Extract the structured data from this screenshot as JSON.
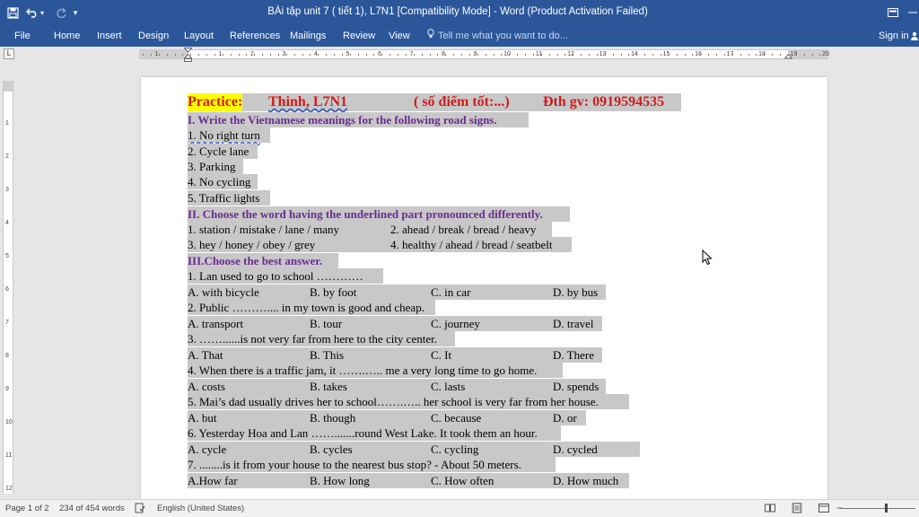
{
  "window": {
    "title": "BÀi tập unit 7 ( tiết 1), L7N1 [Compatibility Mode] - Word (Product Activation Failed)"
  },
  "quick_access": {
    "save_icon": "save-icon",
    "undo_icon": "undo-icon",
    "redo_icon": "redo-icon",
    "customize_icon": "customize-icon"
  },
  "ribbon": {
    "tabs": [
      "File",
      "Home",
      "Insert",
      "Design",
      "Layout",
      "References",
      "Mailings",
      "Review",
      "View"
    ],
    "tell_me": "Tell me what you want to do...",
    "sign_in": "Sign in"
  },
  "ruler": {
    "numbers": [
      "1",
      "1",
      "2",
      "3",
      "4",
      "5",
      "6",
      "7",
      "8",
      "9",
      "10",
      "11",
      "12",
      "13",
      "14",
      "15",
      "16",
      "17",
      "18",
      "19",
      "20"
    ]
  },
  "vruler": {
    "numbers": [
      "1",
      "2",
      "3",
      "4",
      "5",
      "6",
      "7",
      "8",
      "9",
      "10",
      "11",
      "12"
    ]
  },
  "document": {
    "header": {
      "practice": "Practice:",
      "name": "Thinh, L7N1",
      "score": "( số điểm tốt:...)",
      "phone": "Đth gv: 0919594535"
    },
    "section1": {
      "title": "I. Write the Vietnamese meanings for the following road signs.",
      "items": [
        "1. No right turn",
        "2. Cycle lane",
        "3. Parking",
        "4. No cycling",
        "5. Traffic lights"
      ]
    },
    "section2": {
      "title": "II. Choose the word having the underlined part pronounced differently.",
      "q1": "1. station / mistake / lane / many",
      "q2": "2. ahead / break / bread / heavy",
      "q3": "3. hey / honey / obey / grey",
      "q4": "4. healthy / ahead / bread / seatbelt"
    },
    "section3": {
      "title": "III.Choose the best answer.",
      "questions": [
        {
          "q": "1. Lan used to go to school …………",
          "a": "A. with bicycle",
          "b": "B. by foot",
          "c": "C. in car",
          "d": "D. by bus"
        },
        {
          "q": "2. Public ……….... in my town is good and cheap.",
          "a": "A. transport",
          "b": "B. tour",
          "c": "C. journey",
          "d": "D. travel"
        },
        {
          "q": "3. ……......is not very far from here to the city center.",
          "a": "A. That",
          "b": "B. This",
          "c": "C. It",
          "d": "D. There"
        },
        {
          "q": "4. When there is a traffic jam, it …….….. me a very long time to go home.",
          "a": "A. costs",
          "b": "B. takes",
          "c": "C. lasts",
          "d": "D. spends"
        },
        {
          "q": "5. Mai’s dad usually drives her to school…….….. her school is very far from her house.",
          "a": "A. but",
          "b": "B. though",
          "c": "C. because",
          "d": "D. or"
        },
        {
          "q": "6. Yesterday Hoa and Lan …….......round West Lake. It took them an hour.",
          "a": "A. cycle",
          "b": "B. cycles",
          "c": "C. cycling",
          "d": "D. cycled"
        },
        {
          "q": "7. ........is it from your house to the nearest bus stop?  -  About 50 meters.",
          "a": "A.How far",
          "b": "B. How long",
          "c": "C. How often",
          "d": "D. How much"
        }
      ]
    }
  },
  "status": {
    "page": "Page 1 of 2",
    "words": "234 of 454 words",
    "language": "English (United States)"
  },
  "colors": {
    "ribbon": "#2b579a",
    "highlight": "#c8c8c8",
    "practice_bg": "#ffff00",
    "heading_red": "#d11a1a",
    "section_purple": "#6a2a92"
  }
}
